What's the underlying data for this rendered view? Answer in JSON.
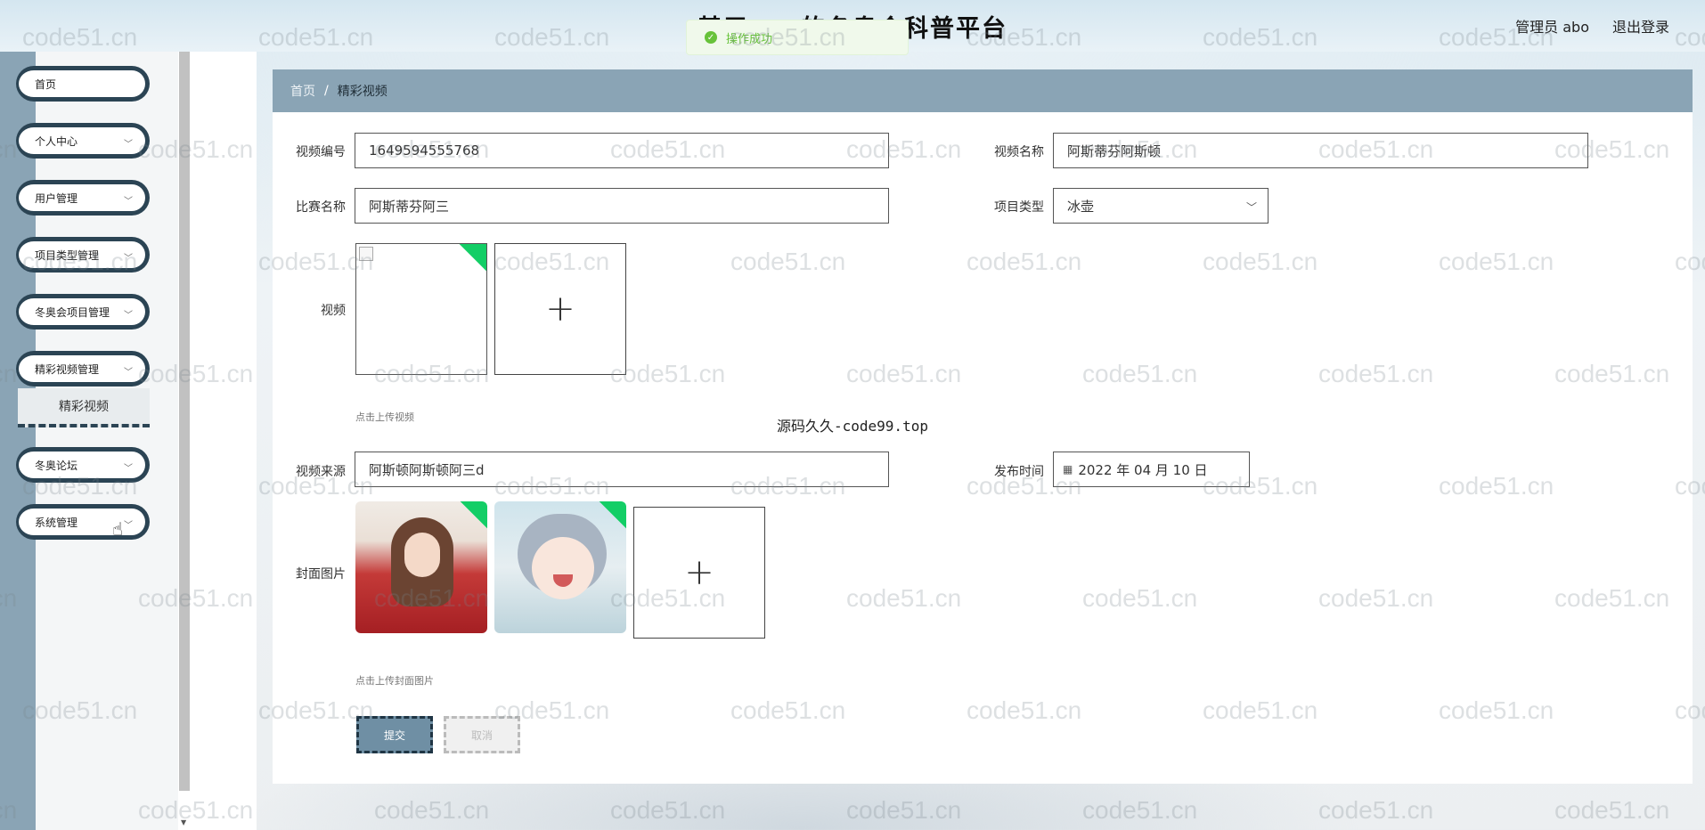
{
  "header": {
    "title": "基于……的冬奥会科普平台",
    "admin": "管理员 abo",
    "logout": "退出登录"
  },
  "toast": {
    "message": "操作成功",
    "icon": "success-check-icon",
    "color": "#67c23a"
  },
  "sidebar": {
    "items": [
      {
        "label": "首页"
      },
      {
        "label": "个人中心"
      },
      {
        "label": "用户管理"
      },
      {
        "label": "项目类型管理"
      },
      {
        "label": "冬奥会项目管理"
      },
      {
        "label": "精彩视频管理"
      },
      {
        "label": "冬奥论坛"
      },
      {
        "label": "系统管理"
      }
    ],
    "active_sub": "精彩视频"
  },
  "breadcrumb": {
    "home": "首页",
    "separator": "/",
    "current": "精彩视频"
  },
  "form": {
    "video_no": {
      "label": "视频编号",
      "value": "1649594555768"
    },
    "video_name": {
      "label": "视频名称",
      "value": "阿斯蒂芬阿斯顿"
    },
    "match_name": {
      "label": "比赛名称",
      "value": "阿斯蒂芬阿三"
    },
    "project_type": {
      "label": "项目类型",
      "value": "冰壶"
    },
    "video": {
      "label": "视频",
      "tip": "点击上传视频"
    },
    "video_source": {
      "label": "视频来源",
      "value": "阿斯顿阿斯顿阿三d"
    },
    "publish_time": {
      "label": "发布时间",
      "value": "2022 年 04 月 10 日",
      "icon": "calendar-icon"
    },
    "cover": {
      "label": "封面图片",
      "tip": "点击上传封面图片"
    },
    "submit": "提交",
    "cancel": "取消"
  },
  "overlay_text": "源码久久-code99.top",
  "watermark": "code51.cn",
  "colors": {
    "accent": "#8aa4b5",
    "sidebar_border": "#2b4454",
    "success": "#13ce66"
  }
}
